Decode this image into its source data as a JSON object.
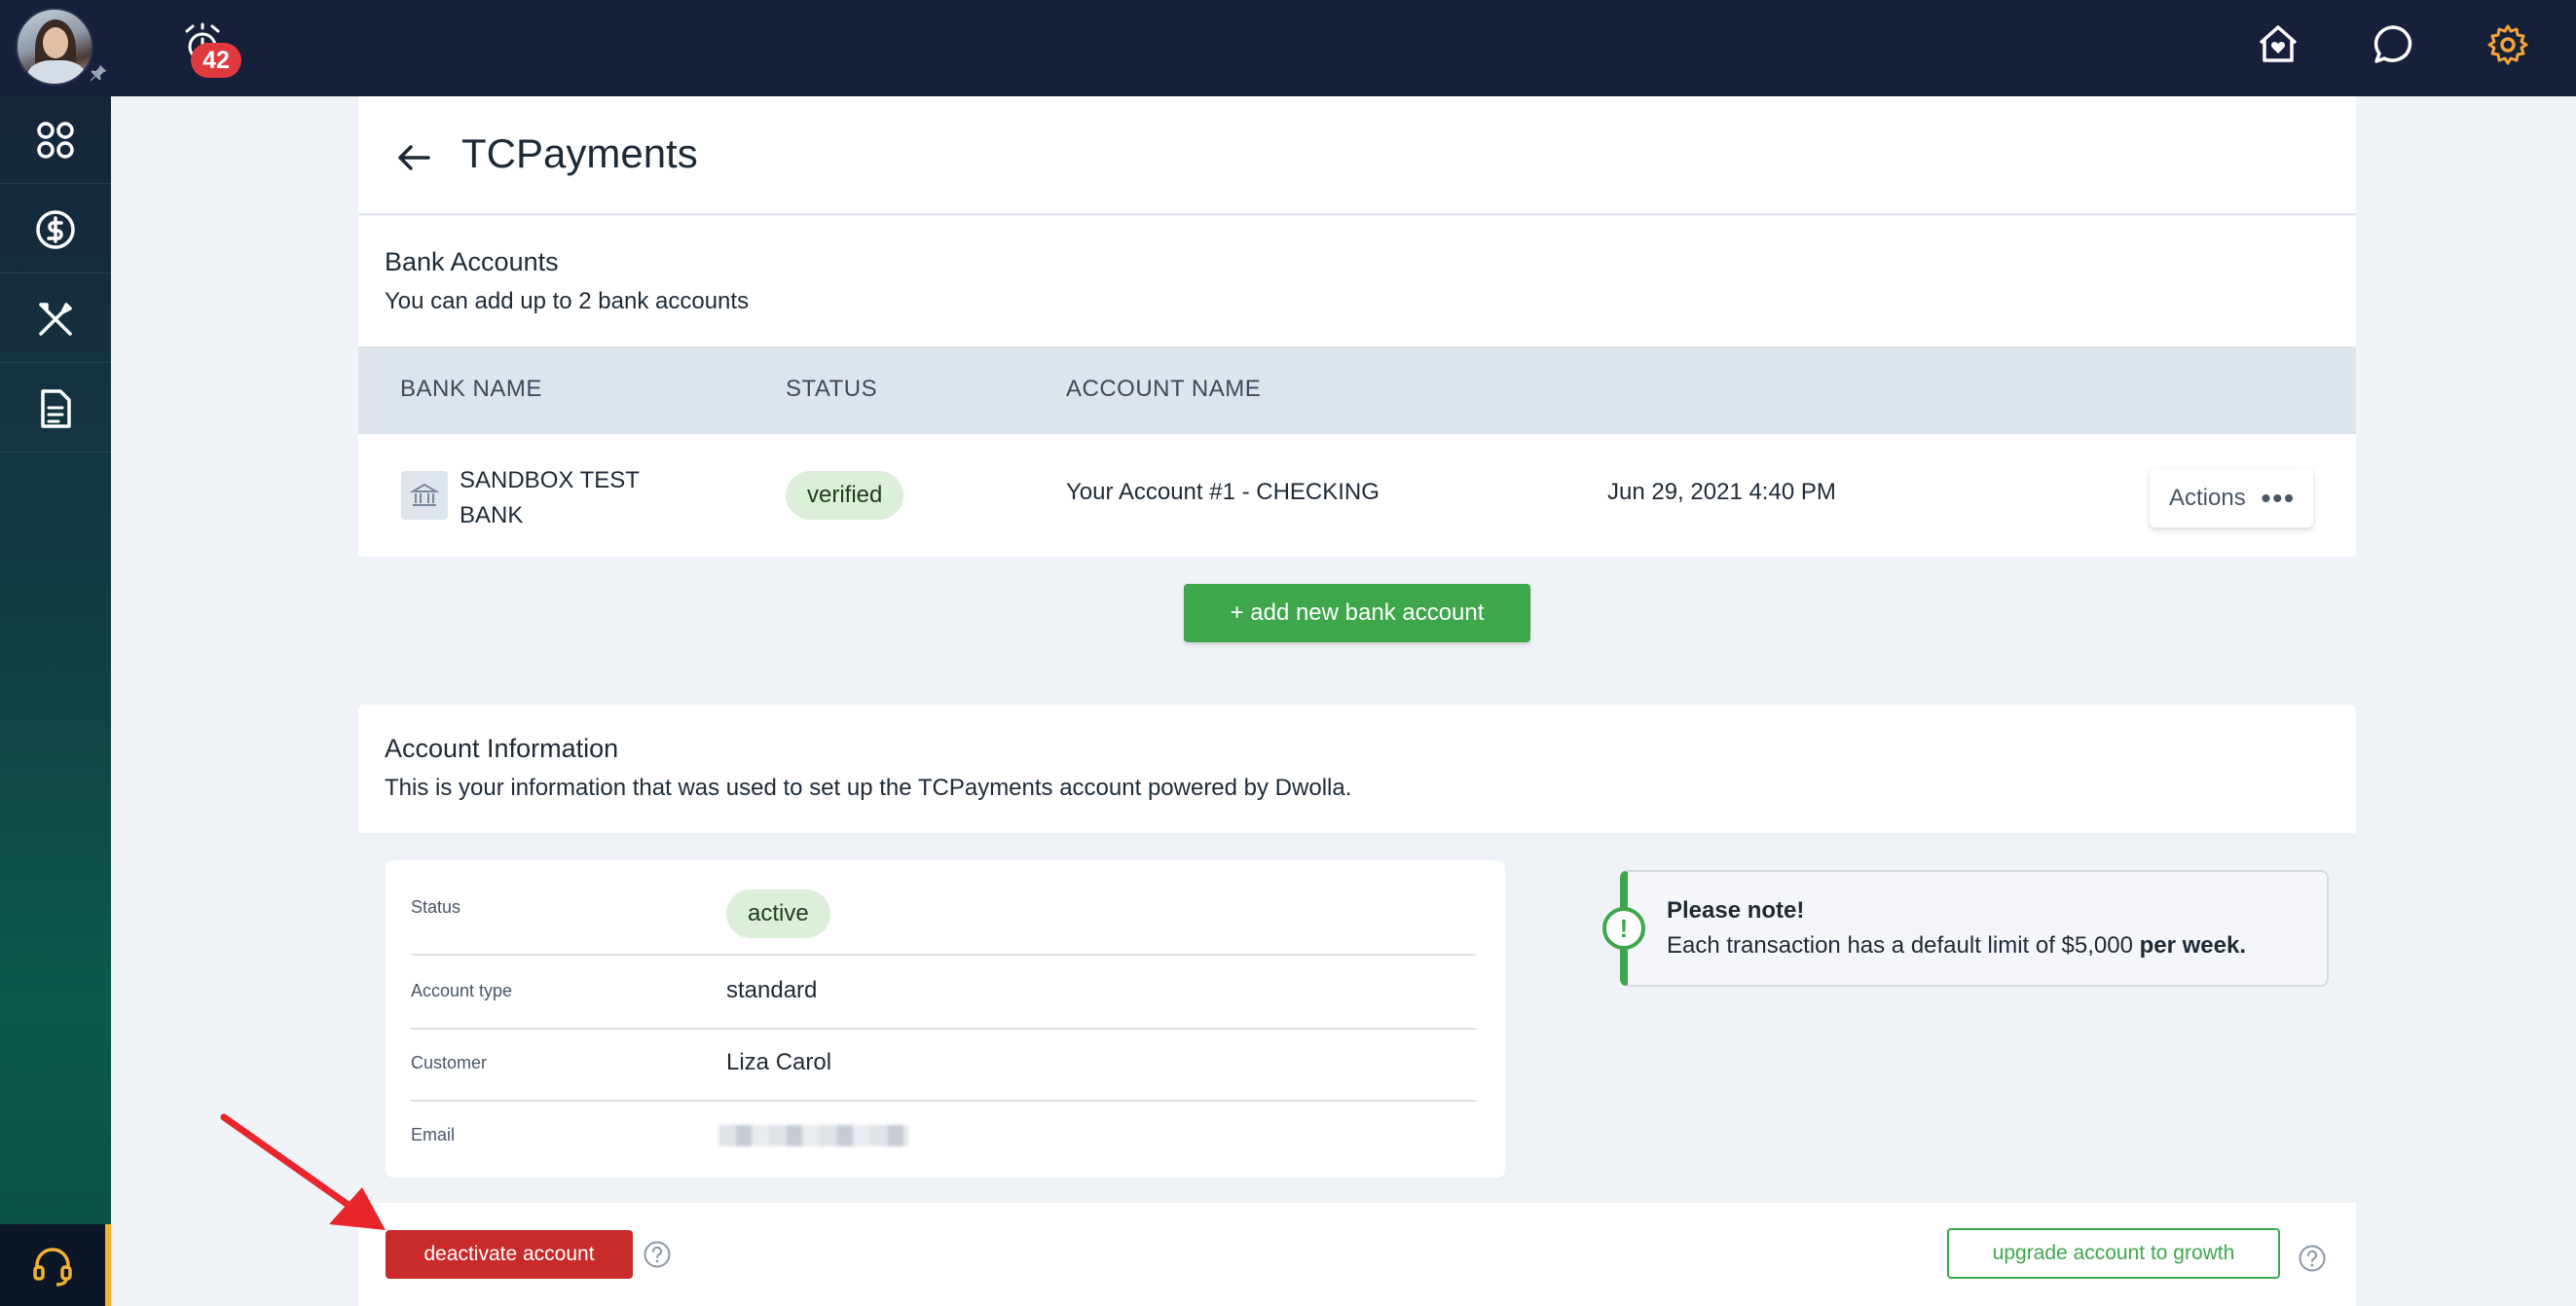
{
  "topbar": {
    "notification_count": "42",
    "icons": [
      "home-heart-icon",
      "chat-icon",
      "gear-icon"
    ],
    "gear_color": "#f2a33a"
  },
  "sidebar": {
    "items": [
      "dashboard-icon",
      "dollar-icon",
      "tools-icon",
      "document-icon"
    ],
    "support": "headset-icon"
  },
  "page": {
    "title": "TCPayments"
  },
  "bank_accounts": {
    "title": "Bank Accounts",
    "subtitle": "You can add up to 2 bank accounts",
    "columns": [
      "BANK NAME",
      "STATUS",
      "ACCOUNT NAME"
    ],
    "rows": [
      {
        "bank_name": "SANDBOX TEST BANK",
        "status": "verified",
        "account_name": "Your Account #1 - CHECKING",
        "date": "Jun 29, 2021 4:40 PM",
        "actions_label": "Actions"
      }
    ],
    "add_button": "+ add new bank account"
  },
  "account_info": {
    "title": "Account Information",
    "subtitle": "This is your information that was used to set up the TCPayments account powered by Dwolla.",
    "fields": [
      {
        "label": "Status",
        "value": "active"
      },
      {
        "label": "Account type",
        "value": "standard"
      },
      {
        "label": "Customer",
        "value": "Liza Carol"
      },
      {
        "label": "Email",
        "value": ""
      }
    ],
    "note_title": "Please note!",
    "note_body_prefix": "Each transaction has a default limit of $5,000 ",
    "note_body_bold": "per week."
  },
  "footer": {
    "deactivate_button": "deactivate account",
    "upgrade_button": "upgrade account to growth"
  },
  "colors": {
    "green": "#3ea74b",
    "red": "#c92a2a",
    "navy": "#16203a"
  }
}
